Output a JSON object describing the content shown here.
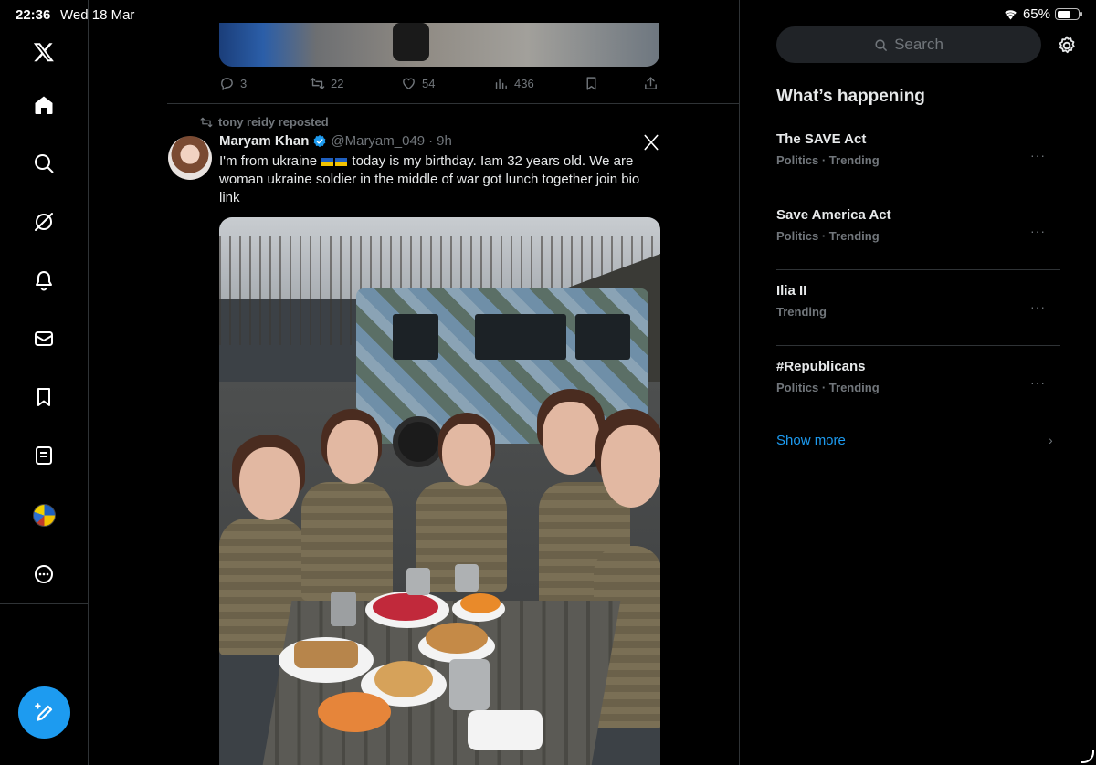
{
  "status_bar": {
    "time": "22:36",
    "date": "Wed 18 Mar",
    "battery_text": "65%",
    "battery_level": 0.65
  },
  "left_nav": {
    "items": [
      {
        "name": "x-logo-icon",
        "label": "X"
      },
      {
        "name": "home-icon",
        "label": "Home"
      },
      {
        "name": "search-icon",
        "label": "Explore"
      },
      {
        "name": "grok-icon",
        "label": "Grok"
      },
      {
        "name": "bell-icon",
        "label": "Notifications"
      },
      {
        "name": "mail-icon",
        "label": "Messages"
      },
      {
        "name": "bookmark-icon",
        "label": "Bookmarks"
      },
      {
        "name": "list-icon",
        "label": "Lists"
      },
      {
        "name": "profile-avatar",
        "label": "Profile"
      },
      {
        "name": "more-icon",
        "label": "More"
      }
    ],
    "compose_icon": "compose-icon"
  },
  "prev_tweet_actions": {
    "replies": "3",
    "reposts": "22",
    "likes": "54",
    "views": "436"
  },
  "tweet": {
    "repost_by": "tony reidy reposted",
    "name": "Maryam Khan",
    "handle": "@Maryam_049",
    "time": "9h",
    "text_part1": "I'm from ukraine",
    "text_part2": "today is my birthday. Iam 32 years old. We are woman ukraine soldier in the middle of war got lunch together join bio link"
  },
  "right_panel": {
    "search_placeholder": "Search",
    "title": "What’s happening",
    "trends": [
      {
        "name": "The SAVE Act",
        "meta": "Politics · Trending"
      },
      {
        "name": "Save America Act",
        "meta": "Politics · Trending"
      },
      {
        "name": "Ilia II",
        "meta": "Trending"
      },
      {
        "name": "#Republicans",
        "meta": "Politics · Trending"
      }
    ],
    "show_more": "Show more",
    "dots": "···",
    "chevron": "›"
  },
  "colors": {
    "accent": "#1d9bf0",
    "background": "#000000",
    "muted": "#71767b",
    "border": "#2f3336"
  }
}
